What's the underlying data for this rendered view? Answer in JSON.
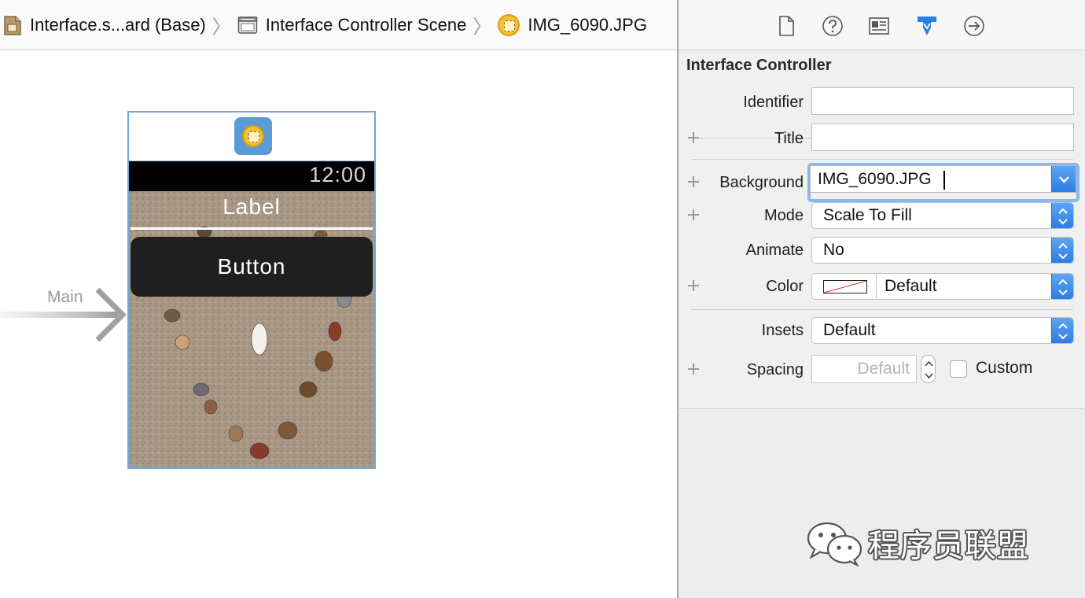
{
  "breadcrumb": {
    "items": [
      {
        "label": "Interface.s...ard (Base)",
        "icon": "storyboard-file-icon"
      },
      {
        "label": "Interface Controller Scene",
        "icon": "scene-icon"
      },
      {
        "label": "IMG_6090.JPG",
        "icon": "image-asset-icon"
      }
    ]
  },
  "canvas": {
    "entry_point_label": "Main",
    "watch": {
      "time": "12:00",
      "label_text": "Label",
      "button_text": "Button"
    }
  },
  "inspector": {
    "tabs": [
      {
        "name": "file-inspector-tab",
        "icon": "document-icon",
        "selected": false
      },
      {
        "name": "quick-help-tab",
        "icon": "question-mark-icon",
        "selected": false
      },
      {
        "name": "identity-inspector-tab",
        "icon": "identity-card-icon",
        "selected": false
      },
      {
        "name": "attributes-inspector-tab",
        "icon": "attributes-shield-icon",
        "selected": true
      },
      {
        "name": "connections-inspector-tab",
        "icon": "arrow-circle-icon",
        "selected": false
      }
    ],
    "section_title": "Interface Controller",
    "identifier": {
      "label": "Identifier",
      "value": ""
    },
    "title": {
      "label": "Title",
      "value": ""
    },
    "background": {
      "label": "Background",
      "value": "IMG_6090.JPG"
    },
    "mode": {
      "label": "Mode",
      "value": "Scale To Fill"
    },
    "animate": {
      "label": "Animate",
      "value": "No"
    },
    "color": {
      "label": "Color",
      "value": "Default"
    },
    "insets": {
      "label": "Insets",
      "value": "Default"
    },
    "spacing": {
      "label": "Spacing",
      "placeholder": "Default",
      "custom_label": "Custom",
      "custom_checked": false
    }
  },
  "watermark": {
    "text": "程序员联盟",
    "icon": "wechat-icon"
  },
  "colors": {
    "accent_blue": "#2c7de6",
    "focus_ring": "#8ab8ec",
    "scene_border": "#6ea8dc"
  }
}
